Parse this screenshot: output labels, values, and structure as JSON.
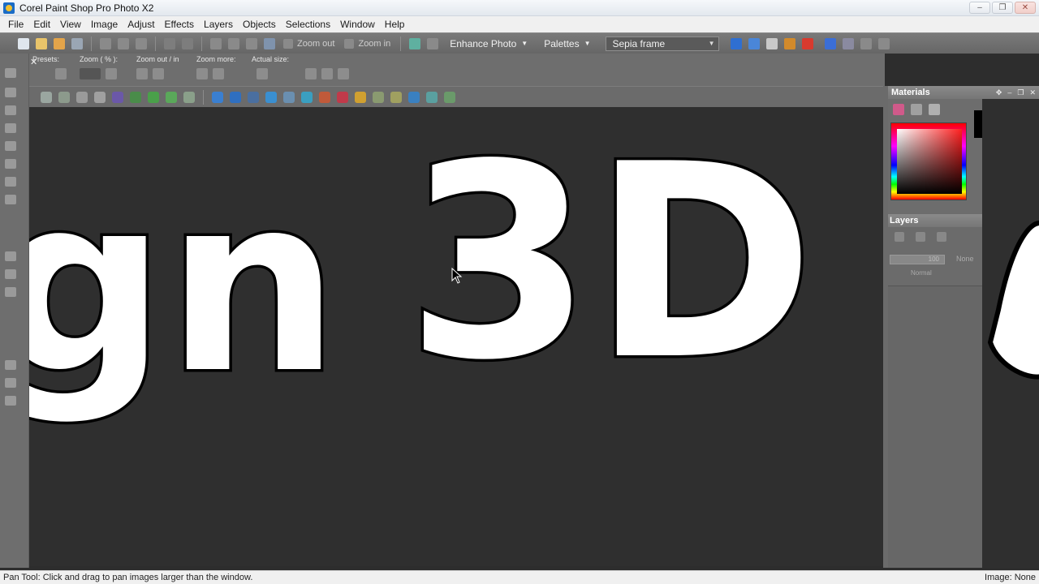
{
  "window": {
    "title": "Corel Paint Shop Pro Photo X2"
  },
  "menu": {
    "items": [
      "File",
      "Edit",
      "View",
      "Image",
      "Adjust",
      "Effects",
      "Layers",
      "Objects",
      "Selections",
      "Window",
      "Help"
    ]
  },
  "toolbar": {
    "zoom_out_label": "Zoom out",
    "zoom_in_label": "Zoom in",
    "enhance_photo_label": "Enhance Photo",
    "palettes_label": "Palettes",
    "script_select_value": "Sepia frame"
  },
  "tool_options": {
    "presets_label": "Presets:",
    "zoom_percent_label": "Zoom ( % ):",
    "zoom_out_in_label": "Zoom out / in",
    "zoom_more_label": "Zoom more:",
    "actual_size_label": "Actual size:"
  },
  "materials": {
    "title": "Materials"
  },
  "layers": {
    "title": "Layers",
    "opacity_value": "100",
    "blend_none": "None",
    "blend_mode": "Normal"
  },
  "canvas": {
    "text_left": "gn",
    "text_right": "3D"
  },
  "status": {
    "hint": "Pan Tool: Click and drag to pan images larger than the window.",
    "image_info": "Image: None"
  }
}
